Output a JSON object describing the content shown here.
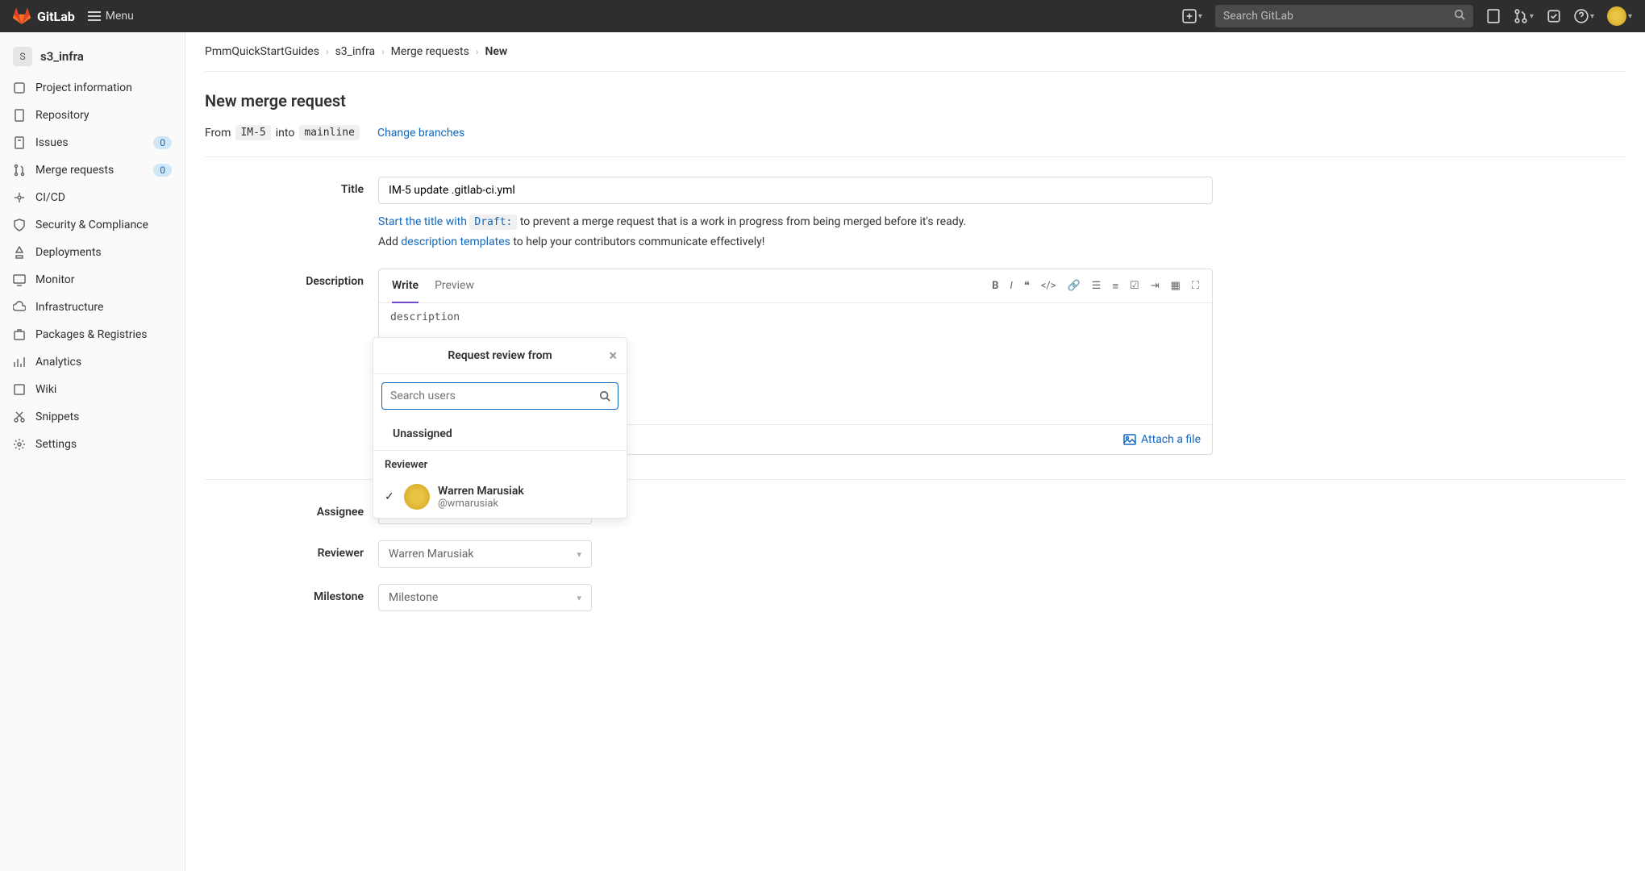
{
  "topnav": {
    "brand": "GitLab",
    "menu": "Menu",
    "search_placeholder": "Search GitLab"
  },
  "sidebar": {
    "project_badge": "S",
    "project_name": "s3_infra",
    "items": [
      {
        "label": "Project information"
      },
      {
        "label": "Repository"
      },
      {
        "label": "Issues",
        "badge": "0"
      },
      {
        "label": "Merge requests",
        "badge": "0"
      },
      {
        "label": "CI/CD"
      },
      {
        "label": "Security & Compliance"
      },
      {
        "label": "Deployments"
      },
      {
        "label": "Monitor"
      },
      {
        "label": "Infrastructure"
      },
      {
        "label": "Packages & Registries"
      },
      {
        "label": "Analytics"
      },
      {
        "label": "Wiki"
      },
      {
        "label": "Snippets"
      },
      {
        "label": "Settings"
      }
    ]
  },
  "breadcrumb": [
    "PmmQuickStartGuides",
    "s3_infra",
    "Merge requests",
    "New"
  ],
  "page": {
    "title": "New merge request",
    "from_label": "From",
    "from_branch": "IM-5",
    "into_label": "into",
    "into_branch": "mainline",
    "change_branches": "Change branches"
  },
  "form": {
    "title_label": "Title",
    "title_value": "IM-5 update .gitlab-ci.yml",
    "draft_hint_prefix": "Start the title with ",
    "draft_chip": "Draft:",
    "draft_hint_suffix": " to prevent a merge request that is a work in progress from being merged before it's ready.",
    "template_hint_prefix": "Add ",
    "template_link": "description templates",
    "template_hint_suffix": " to help your contributors communicate effectively!",
    "description_label": "Description",
    "write_tab": "Write",
    "preview_tab": "Preview",
    "description_value": "description",
    "attach_file": "Attach a file",
    "assignee_label": "Assignee",
    "reviewer_label": "Reviewer",
    "reviewer_value": "Warren Marusiak",
    "milestone_label": "Milestone",
    "milestone_value": "Milestone"
  },
  "popover": {
    "title": "Request review from",
    "search_placeholder": "Search users",
    "unassigned": "Unassigned",
    "section": "Reviewer",
    "user_name": "Warren Marusiak",
    "user_handle": "@wmarusiak"
  }
}
